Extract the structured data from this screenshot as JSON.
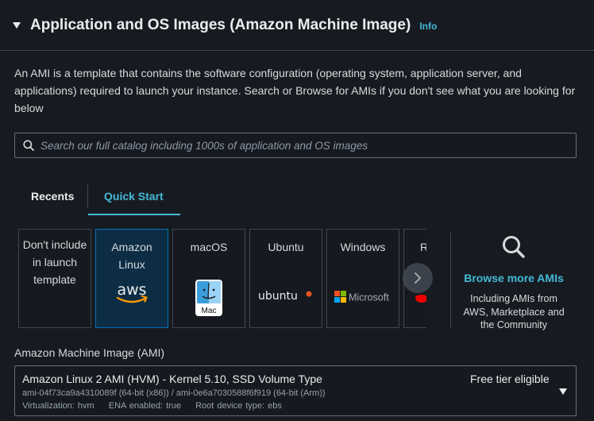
{
  "header": {
    "title": "Application and OS Images (Amazon Machine Image)",
    "info": "Info"
  },
  "description": "An AMI is a template that contains the software configuration (operating system, application server, and applications) required to launch your instance. Search or Browse for AMIs if you don't see what you are looking for below",
  "search": {
    "placeholder": "Search our full catalog including 1000s of application and OS images"
  },
  "tabs": [
    {
      "label": "Recents"
    },
    {
      "label": "Quick Start"
    }
  ],
  "cards": [
    {
      "label": "Don't include in launch template"
    },
    {
      "label": "Amazon Linux",
      "logo_text": "aws"
    },
    {
      "label": "macOS",
      "logo_text": "Mac"
    },
    {
      "label": "Ubuntu",
      "logo_text": "ubuntu"
    },
    {
      "label": "Windows",
      "logo_text": "Microsoft"
    },
    {
      "label": "R"
    }
  ],
  "browse": {
    "link": "Browse more AMIs",
    "sub": "Including AMIs from AWS, Marketplace and the Community"
  },
  "ami": {
    "label": "Amazon Machine Image (AMI)",
    "name": "Amazon Linux 2 AMI (HVM) - Kernel 5.10, SSD Volume Type",
    "badge": "Free tier eligible",
    "ids": "ami-04f73ca9a4310089f (64-bit (x86)) / ami-0e6a7030588f6f919 (64-bit (Arm))",
    "virtualization": "Virtualization: hvm",
    "ena": "ENA enabled: true",
    "root": "Root device type: ebs"
  },
  "colors": {
    "accent": "#44b9d6",
    "selected_border": "#0073bb",
    "background": "#16191f"
  }
}
